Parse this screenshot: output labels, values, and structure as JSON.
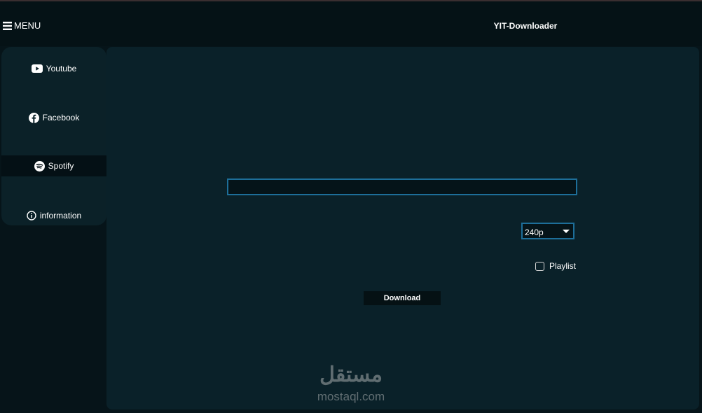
{
  "header": {
    "menu_label": "MENU",
    "menu_icon": "hamburger-icon",
    "app_title": "YIT-Downloader"
  },
  "sidebar": {
    "items": [
      {
        "label": "Youtube",
        "icon": "youtube-icon",
        "active": false
      },
      {
        "label": "Facebook",
        "icon": "facebook-icon",
        "active": false
      },
      {
        "label": "Spotify",
        "icon": "spotify-icon",
        "active": true
      },
      {
        "label": "information",
        "icon": "info-icon",
        "active": false
      }
    ]
  },
  "main": {
    "url_input": {
      "value": "",
      "placeholder": ""
    },
    "quality": {
      "selected": "240p"
    },
    "playlist": {
      "label": "Playlist",
      "checked": false
    },
    "download_label": "Download"
  },
  "watermark": {
    "brand": "مستقل",
    "domain": "mostaql.com"
  },
  "colors": {
    "page_bg": "#061419",
    "panel_bg": "#0a2129",
    "sidebar_bg": "#0b2128",
    "active_item_bg": "#041015",
    "input_border": "#1d6e99",
    "button_bg": "#051114"
  }
}
